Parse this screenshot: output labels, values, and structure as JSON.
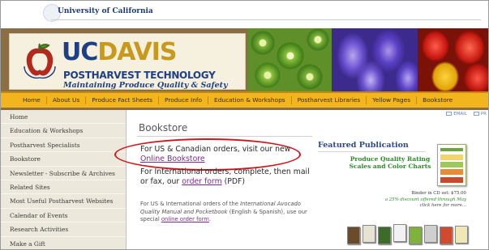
{
  "uc": {
    "title": "University of California"
  },
  "header": {
    "brand_uc": "UC",
    "brand_davis": "DAVIS",
    "program": "POSTHARVEST TECHNOLOGY",
    "tagline": "Maintaining Produce Quality & Safety",
    "photos": [
      "kiwi",
      "iris",
      "peppers"
    ]
  },
  "nav": {
    "items": [
      "Home",
      "About Us",
      "Produce Fact Sheets",
      "Produce Info",
      "Education & Workshops",
      "Postharvest Libraries",
      "Yellow Pages",
      "Bookstore"
    ]
  },
  "sidebar": {
    "items": [
      "Home",
      "Education & Workshops",
      "Postharvest Specialists",
      "Bookstore",
      "Newsletter - Subscribe & Archives",
      "Related Sites",
      "Most Useful Postharvest Websites",
      "Calendar of Events",
      "Research Activities",
      "Make a Gift"
    ]
  },
  "tools": {
    "email": "EMAIL",
    "print": "PR"
  },
  "main": {
    "title": "Bookstore",
    "us_text": "For US & Canadian orders, visit our new ",
    "us_link": "Online Bookstore",
    "intl_text": "For International orders, complete, then mail or fax, our ",
    "intl_link": "order form",
    "intl_suffix": " (PDF)",
    "avocado_pre": "For US & International orders of the ",
    "avocado_italic": "International Avocado Quality Manual and Pocketbook",
    "avocado_mid": " (English & Spanish), use our special ",
    "avocado_link": "online order form",
    "avocado_end": "."
  },
  "featured": {
    "heading": "Featured Publication",
    "title": "Produce Quality Rating Scales and Color Charts",
    "binder": "Binder in CD set: $75.00",
    "discount": "a 25% discount offered through May",
    "click": "click here for more..."
  },
  "colors": {
    "brown": "#8b6e44",
    "gold": "#f2b51e",
    "highlight": "#d0161b",
    "link": "#7b2c88"
  }
}
